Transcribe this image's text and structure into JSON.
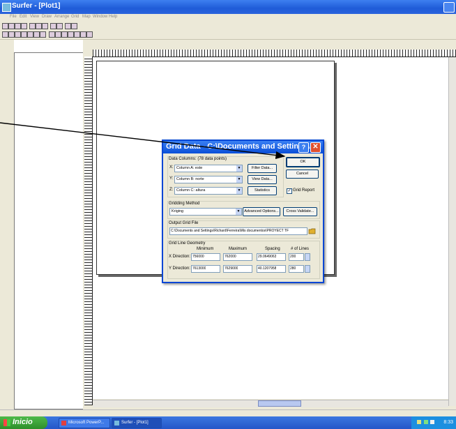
{
  "window": {
    "title": "Surfer - [Plot1]"
  },
  "menubar": {
    "items": [
      "File",
      "Edit",
      "View",
      "Draw",
      "Arrange",
      "Grid",
      "Map",
      "Window",
      "Help"
    ]
  },
  "dialog": {
    "title": "Grid Data - C:\\Documents and Settings\\...",
    "data_columns_label": "Data Columns:  (78 data points)",
    "x_label": "X:",
    "x_value": "Column A:  este",
    "y_label": "Y:",
    "y_value": "Column B:  norte",
    "z_label": "Z:",
    "z_value": "Column C:  altura",
    "filter_data": "Filter Data...",
    "view_data": "View Data...",
    "statistics": "Statistics",
    "ok": "OK",
    "cancel": "Cancel",
    "grid_report": "Grid Report",
    "gridding_method_label": "Gridding Method",
    "gridding_method_value": "Kriging",
    "advanced_options": "Advanced Options...",
    "cross_validate": "Cross Validate...",
    "output_grid_label": "Output Grid File",
    "output_grid_value": "C:\\Documents and Settings\\Richard\\Ferreira\\Mis documentos\\PROYECT TF",
    "grid_geometry_label": "Grid Line Geometry",
    "col_min": "Minimum",
    "col_max": "Maximum",
    "col_spacing": "Spacing",
    "col_lines": "# of Lines",
    "x_dir_label": "X Direction:",
    "x_min": "756000",
    "x_max": "762000",
    "x_spacing": "29.0649063",
    "x_lines": "200",
    "y_dir_label": "Y Direction:",
    "y_min": "7613000",
    "y_max": "7629000",
    "y_spacing": "40.1207958",
    "y_lines": "280"
  },
  "taskbar": {
    "start": "Inicio",
    "tasks": [
      "Microsoft PowerP...",
      "Surfer - [Plot1]"
    ],
    "clock": "8:33"
  }
}
